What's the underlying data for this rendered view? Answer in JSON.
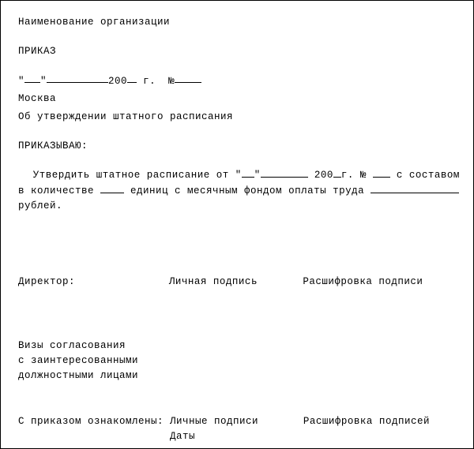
{
  "header": {
    "org_label": "Наименование организации",
    "title": "ПРИКАЗ",
    "date_open_quote": "\"",
    "date_close_quote": "\"",
    "date_year_prefix": "200",
    "date_year_suffix": "г.",
    "number_sign": "№",
    "city": "Москва",
    "subject": "Об утверждении штатного расписания"
  },
  "order": {
    "lead": "ПРИКАЗЫВАЮ:",
    "body_start": "Утвердить штатное расписание от \"",
    "body_after_day_quote": "\"",
    "body_year_prefix": " 200",
    "body_year_suffix": "г. № ",
    "body_after_number": " с составом",
    "line2_part1": "в количестве ",
    "line2_part2": " единиц с месячным фондом оплаты труда ",
    "line3": "рублей."
  },
  "sign": {
    "left": "Директор:",
    "mid": "Личная подпись",
    "right": "Расшифровка подписи"
  },
  "visa": {
    "l1": "Визы согласования",
    "l2": "с заинтересованными",
    "l3": "должностными лицами"
  },
  "ack": {
    "left": "С приказом ознакомлены:",
    "mid_line1": "Личные подписи",
    "mid_line2": "Даты",
    "right": "Расшифровка подписей"
  }
}
